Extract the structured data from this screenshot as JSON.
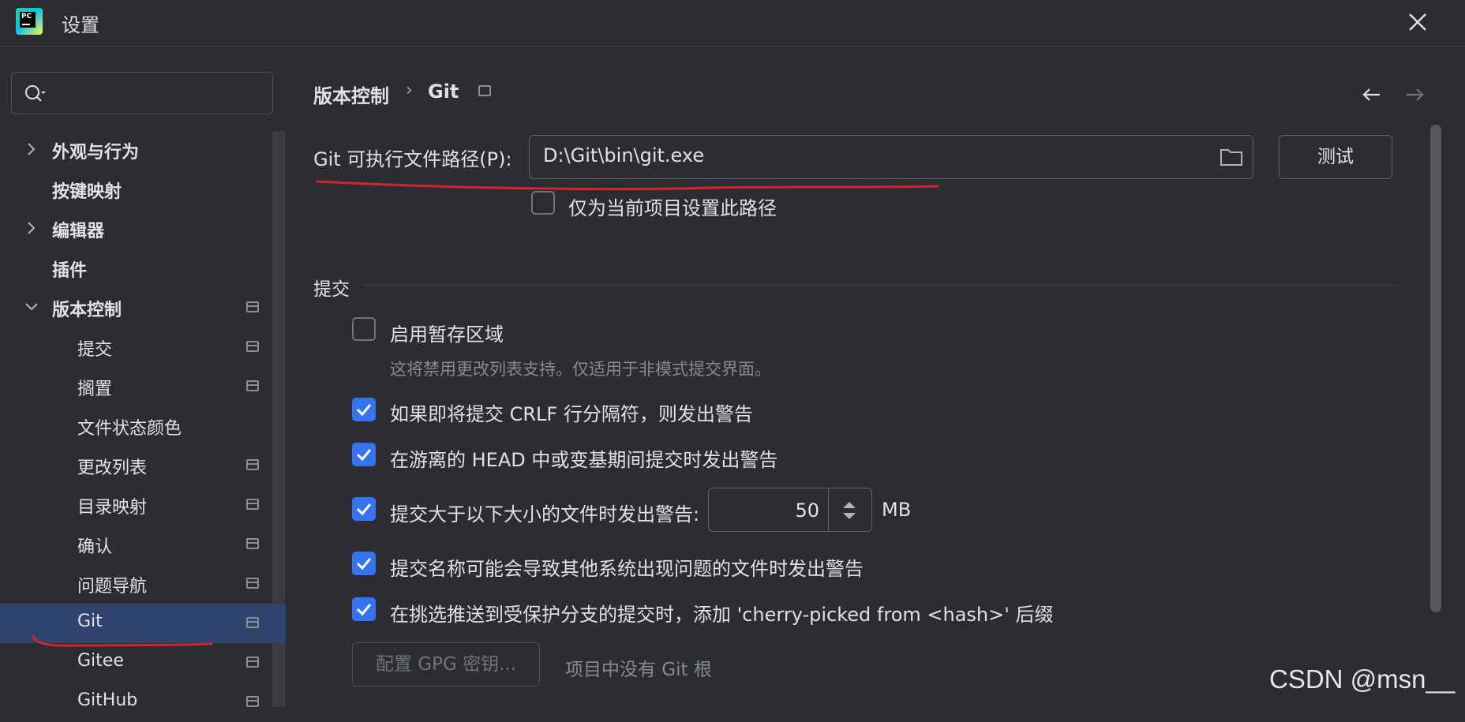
{
  "window": {
    "title": "设置",
    "app_icon_text": "PC"
  },
  "sidebar": {
    "search_placeholder": "",
    "items": [
      {
        "label": "外观与行为",
        "arrow": "right"
      },
      {
        "label": "按键映射"
      },
      {
        "label": "编辑器",
        "arrow": "right"
      },
      {
        "label": "插件"
      },
      {
        "label": "版本控制",
        "arrow": "down"
      },
      {
        "label": "提交"
      },
      {
        "label": "搁置"
      },
      {
        "label": "文件状态颜色"
      },
      {
        "label": "更改列表"
      },
      {
        "label": "目录映射"
      },
      {
        "label": "确认"
      },
      {
        "label": "问题导航"
      },
      {
        "label": "Git",
        "selected": true
      },
      {
        "label": "Gitee"
      },
      {
        "label": "GitHub"
      }
    ]
  },
  "breadcrumb": {
    "parent": "版本控制",
    "separator": "›",
    "current": "Git"
  },
  "git_path": {
    "label": "Git 可执行文件路径(P):",
    "value": "D:\\Git\\bin\\git.exe",
    "test_button": "测试",
    "project_only_label": "仅为当前项目设置此路径"
  },
  "commit_section": {
    "title": "提交",
    "staging_label": "启用暂存区域",
    "staging_hint": "这将禁用更改列表支持。仅适用于非模式提交界面。",
    "crlf_label": "如果即将提交 CRLF 行分隔符，则发出警告",
    "head_label": "在游离的 HEAD 中或变基期间提交时发出警告",
    "size_label": "提交大于以下大小的文件时发出警告:",
    "size_value": "50",
    "size_unit": "MB",
    "name_label": "提交名称可能会导致其他系统出现问题的文件时发出警告",
    "cherry_label": "在挑选推送到受保护分支的提交时，添加 'cherry-picked from <hash>' 后缀",
    "gpg_button": "配置 GPG 密钥...",
    "no_git_root": "项目中没有 Git 根"
  },
  "watermark": "CSDN @msn__",
  "colors": {
    "accent": "#3574f0",
    "selected_row": "#2e436e",
    "annotation": "#d0262b"
  }
}
